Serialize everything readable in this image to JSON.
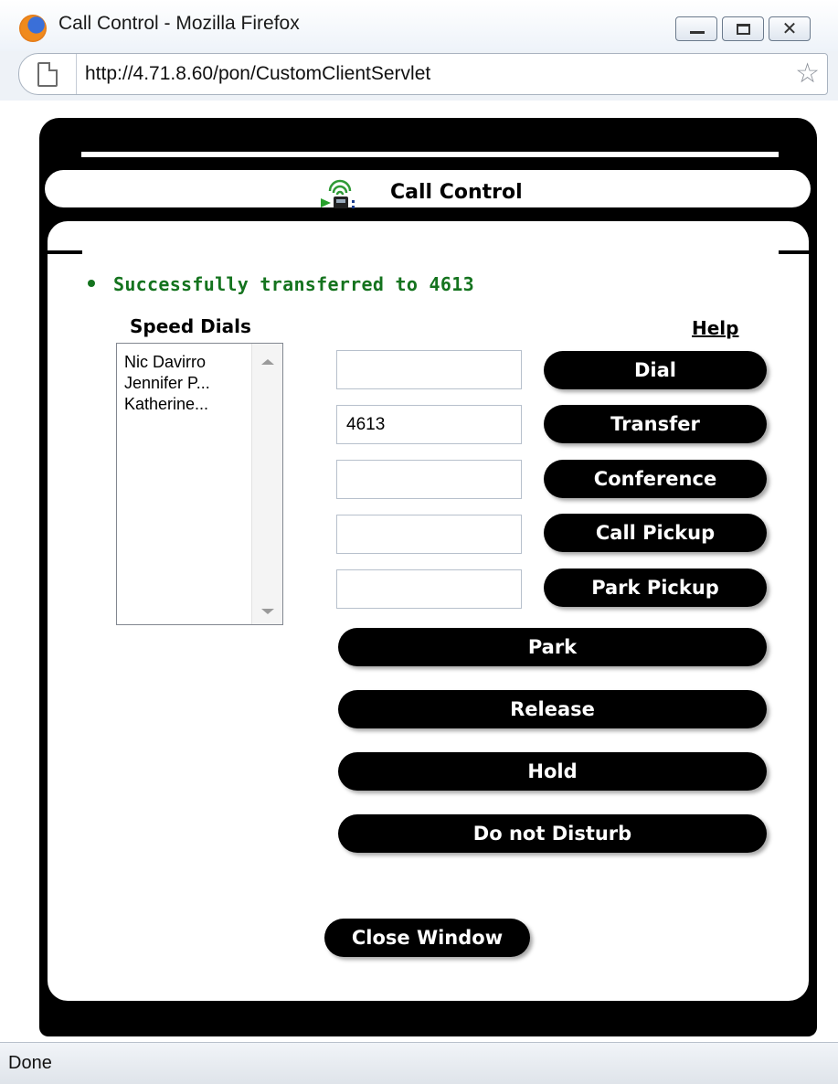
{
  "window": {
    "title": "Call Control - Mozilla Firefox",
    "url": "http://4.71.8.60/pon/CustomClientServlet",
    "status": "Done",
    "close_glyph": "✕",
    "star_glyph": "☆"
  },
  "call_control": {
    "title": "Call Control",
    "status_message": "Successfully transferred to 4613",
    "speed_dials_label": "Speed Dials",
    "help_label": "Help",
    "speed_dials": [
      "Nic Davirro",
      "Jennifer P...",
      "Katherine..."
    ],
    "fields": {
      "dial": "",
      "transfer": "4613",
      "conference": "",
      "call_pickup": "",
      "park_pickup": ""
    },
    "buttons": {
      "dial": "Dial",
      "transfer": "Transfer",
      "conference": "Conference",
      "call_pickup": "Call Pickup",
      "park_pickup": "Park Pickup",
      "park": "Park",
      "release": "Release",
      "hold": "Hold",
      "do_not_disturb": "Do not Disturb",
      "close_window": "Close Window"
    }
  },
  "colors": {
    "frame": "#000000",
    "success": "#14731e"
  },
  "icons": [
    "firefox-logo-icon",
    "page-icon",
    "bookmark-star-icon",
    "phone-signal-icon"
  ]
}
